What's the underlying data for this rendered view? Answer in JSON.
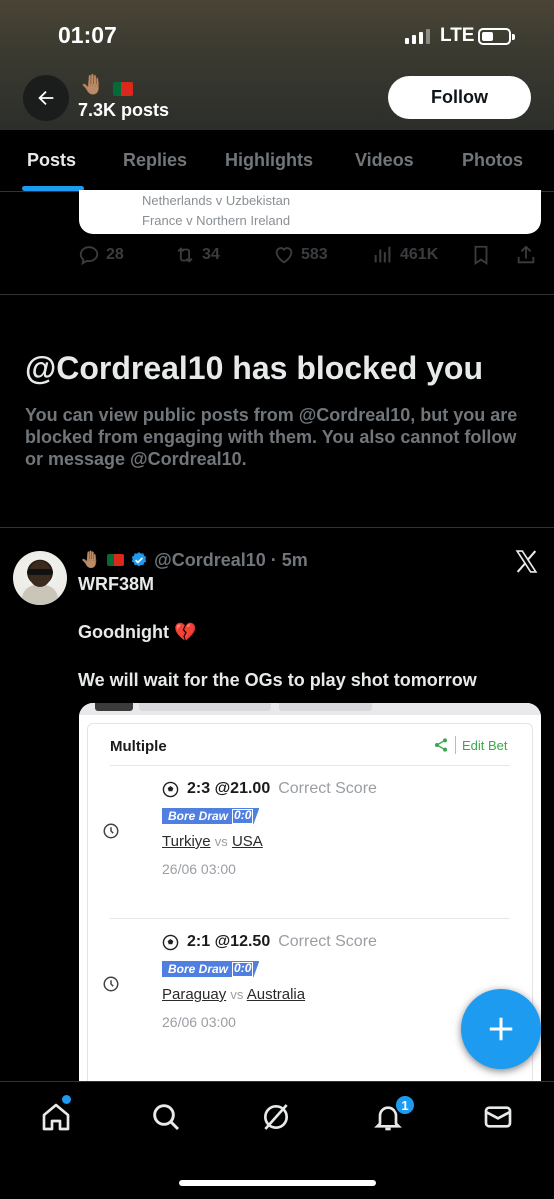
{
  "status_bar": {
    "time": "01:07",
    "network": "LTE"
  },
  "header": {
    "emoji": "🤚🏽",
    "posts_count": "7.3K posts",
    "follow_label": "Follow"
  },
  "tabs": [
    {
      "label": "Posts",
      "active": true
    },
    {
      "label": "Replies",
      "active": false
    },
    {
      "label": "Highlights",
      "active": false
    },
    {
      "label": "Videos",
      "active": false
    },
    {
      "label": "Photos",
      "active": false
    }
  ],
  "previous_post": {
    "card_lines": [
      "Netherlands v Uzbekistan",
      "France v Northern Ireland"
    ],
    "replies": "28",
    "reposts": "34",
    "likes": "583",
    "views": "461K"
  },
  "blocked": {
    "title": "@Cordreal10 has blocked you",
    "description": "You can view public posts from @Cordreal10, but you are blocked from engaging with them. You also cannot follow or message @Cordreal10."
  },
  "post": {
    "emoji": "🤚🏽",
    "handle": "@Cordreal10 · 5m",
    "name": "WRF38M",
    "line1": "Goodnight 💔",
    "line2": "We will wait for the OGs to play shot tomorrow"
  },
  "bet_slip": {
    "title": "Multiple",
    "edit_label": "Edit Bet",
    "tag": "Bore Draw",
    "tag_score": "0:0",
    "selections": [
      {
        "pick": "2:3 @21.00",
        "market": "Correct Score",
        "home": "Turkiye",
        "vs": "vs",
        "away": "USA",
        "kickoff": "26/06 03:00"
      },
      {
        "pick": "2:1 @12.50",
        "market": "Correct Score",
        "home": "Paraguay",
        "vs": "vs",
        "away": "Australia",
        "kickoff": "26/06 03:00"
      }
    ]
  },
  "nav": {
    "notification_count": "1"
  },
  "colors": {
    "accent": "#1d9bf0",
    "background": "#000000",
    "muted": "#71767b",
    "bet_green": "#3ca64d",
    "tag_blue": "#4f7fe0"
  }
}
